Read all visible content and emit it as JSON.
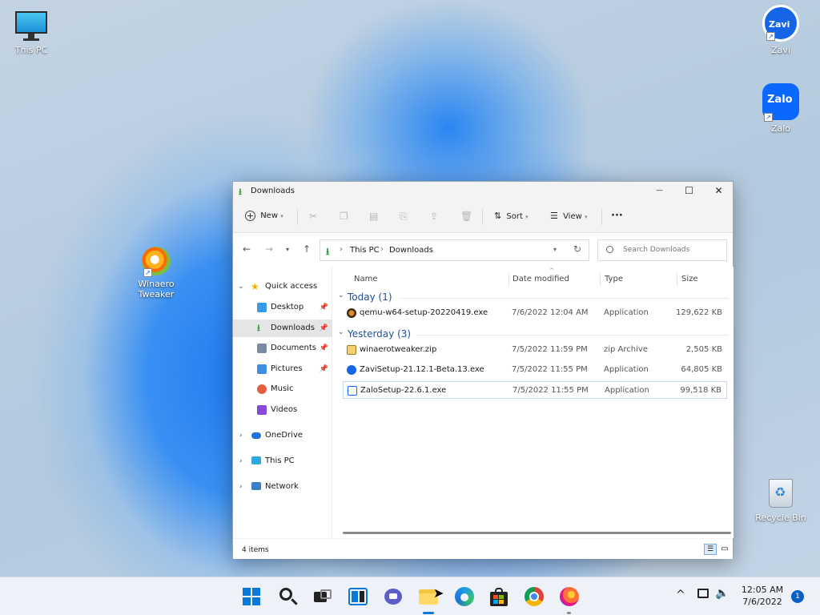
{
  "desktop": {
    "icons": [
      {
        "label": "This PC"
      },
      {
        "label": "Zavi"
      },
      {
        "label": "Zalo"
      },
      {
        "label": "Winaero Tweaker"
      },
      {
        "label": "Recycle Bin"
      }
    ],
    "zavi_logo_text": "Zavi",
    "zalo_logo_text": "Zalo"
  },
  "window": {
    "title": "Downloads",
    "controls": {
      "minimize": "—",
      "maximize": "☐",
      "close": "✕"
    },
    "commandbar": {
      "new_label": "New",
      "sort_label": "Sort",
      "view_label": "View",
      "more": "···"
    },
    "address": {
      "root": "This PC",
      "sep": "›",
      "current": "Downloads"
    },
    "search_placeholder": "Search Downloads",
    "nav": {
      "quick_access": "Quick access",
      "items": [
        {
          "label": "Desktop"
        },
        {
          "label": "Downloads"
        },
        {
          "label": "Documents"
        },
        {
          "label": "Pictures"
        },
        {
          "label": "Music"
        },
        {
          "label": "Videos"
        }
      ],
      "onedrive": "OneDrive",
      "this_pc": "This PC",
      "network": "Network"
    },
    "columns": {
      "name": "Name",
      "date": "Date modified",
      "type": "Type",
      "size": "Size"
    },
    "groups": [
      {
        "label": "Today (1)",
        "files": [
          {
            "name": "qemu-w64-setup-20220419.exe",
            "date": "7/6/2022 12:04 AM",
            "type": "Application",
            "size": "129,622 KB"
          }
        ]
      },
      {
        "label": "Yesterday (3)",
        "files": [
          {
            "name": "winaerotweaker.zip",
            "date": "7/5/2022 11:59 PM",
            "type": "zip Archive",
            "size": "2,505 KB"
          },
          {
            "name": "ZaviSetup-21.12.1-Beta.13.exe",
            "date": "7/5/2022 11:55 PM",
            "type": "Application",
            "size": "64,805 KB"
          },
          {
            "name": "ZaloSetup-22.6.1.exe",
            "date": "7/5/2022 11:55 PM",
            "type": "Application",
            "size": "99,518 KB"
          }
        ]
      }
    ],
    "status": "4 items"
  },
  "taskbar": {
    "time": "12:05 AM",
    "date": "7/6/2022",
    "notification_count": "1",
    "icons": [
      "start-icon",
      "search-icon",
      "task-view-icon",
      "widgets-icon",
      "chat-icon",
      "file-explorer-icon",
      "edge-icon",
      "store-icon",
      "chrome-icon",
      "firefox-icon"
    ]
  },
  "colors": {
    "accent": "#0067c0",
    "group_header": "#1e4f9c",
    "selection": "#cce4f7"
  }
}
